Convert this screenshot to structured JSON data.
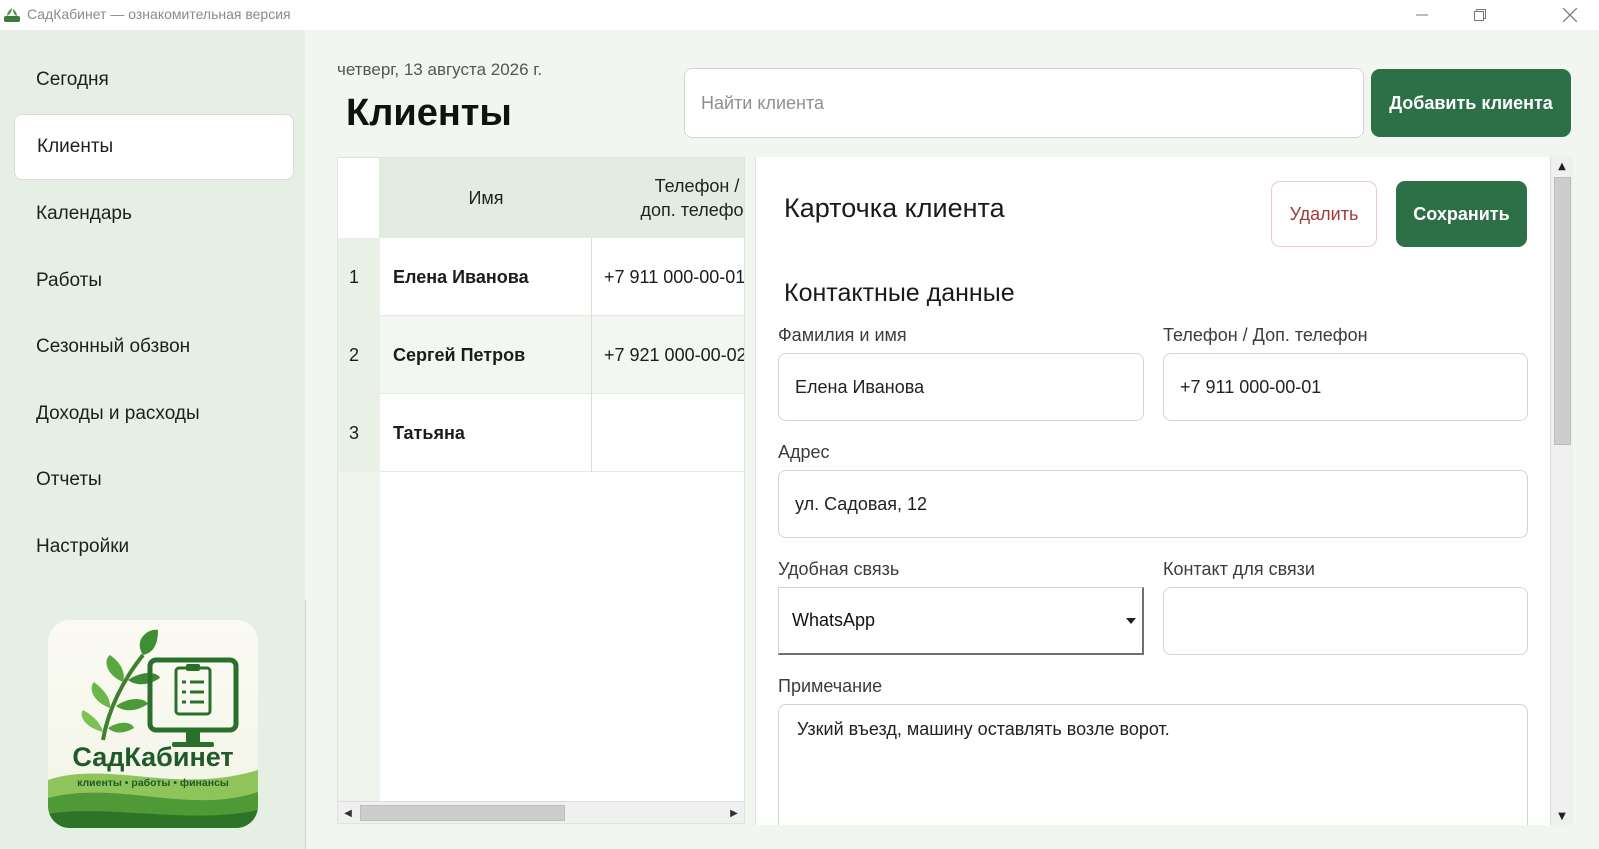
{
  "window": {
    "title": "СадКабинет — ознакомительная версия",
    "icon": "leaf-app-icon"
  },
  "sidebar": {
    "items": [
      {
        "label": "Сегодня"
      },
      {
        "label": "Клиенты",
        "active": true
      },
      {
        "label": "Календарь"
      },
      {
        "label": "Работы"
      },
      {
        "label": "Сезонный обзвон"
      },
      {
        "label": "Доходы и расходы"
      },
      {
        "label": "Отчеты"
      },
      {
        "label": "Настройки"
      }
    ],
    "logo": {
      "name": "СадКабинет",
      "tagline": "клиенты • работы • финансы"
    }
  },
  "header": {
    "date": "четверг, 13 августа 2026 г.",
    "title": "Клиенты",
    "search_placeholder": "Найти клиента",
    "add_button": "Добавить клиента"
  },
  "table": {
    "columns": [
      "Имя",
      "Телефон /\nдоп. телефон"
    ],
    "rows": [
      {
        "num": "1",
        "name": "Елена Иванова",
        "phone": "+7 911 000-00-01"
      },
      {
        "num": "2",
        "name": "Сергей Петров",
        "phone": "+7 921 000-00-02"
      },
      {
        "num": "3",
        "name": "Татьяна",
        "phone": ""
      }
    ]
  },
  "card": {
    "title": "Карточка клиента",
    "delete_button": "Удалить",
    "save_button": "Сохранить",
    "section_title": "Контактные данные",
    "fields": {
      "name_label": "Фамилия и имя",
      "name_value": "Елена Иванова",
      "phone_label": "Телефон / Доп. телефон",
      "phone_value": "+7 911 000-00-01",
      "address_label": "Адрес",
      "address_value": "ул. Садовая, 12",
      "contact_method_label": "Удобная связь",
      "contact_method_value": "WhatsApp",
      "contact_label": "Контакт для связи",
      "contact_value": "",
      "note_label": "Примечание",
      "note_value": "Узкий въезд, машину оставлять возле ворот."
    }
  },
  "colors": {
    "accent": "#2d6f47",
    "sidebar_bg": "#e6efe4",
    "danger": "#a33a3a"
  }
}
